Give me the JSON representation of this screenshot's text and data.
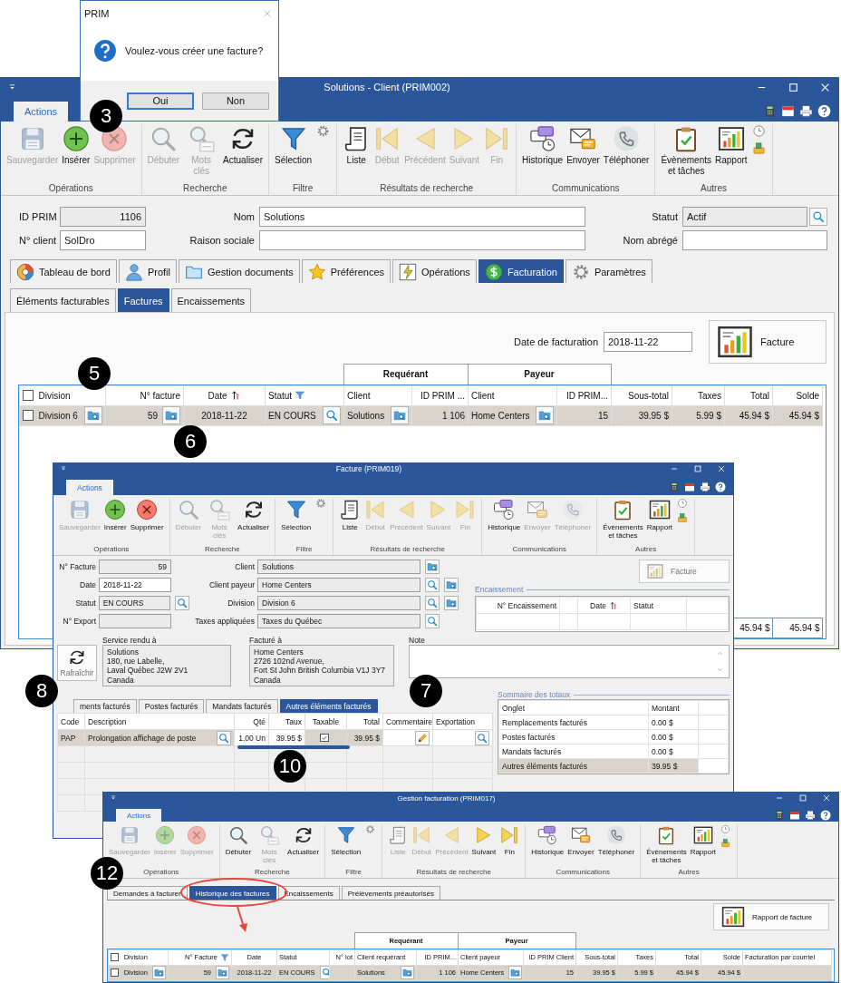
{
  "dialog": {
    "title": "PRIM",
    "message": "Voulez-vous créer une facture?",
    "buttons": [
      {
        "label": "Oui",
        "selected": true
      },
      {
        "label": "Non",
        "selected": false
      }
    ]
  },
  "windows": [
    {
      "kind": "client",
      "title": "Solutions - Client (PRIM002)",
      "ribbon_tabs": [
        {
          "label": "Actions",
          "selected": true
        }
      ],
      "groups": [
        {
          "label": "Opérations",
          "buttons": [
            {
              "kind": "save",
              "label": "Sauvegarder",
              "disabled": true
            },
            {
              "kind": "add",
              "label": "Insérer",
              "disabled": false
            },
            {
              "kind": "delete",
              "label": "Supprimer",
              "disabled": true
            }
          ]
        },
        {
          "label": "Recherche",
          "buttons": [
            {
              "kind": "search",
              "label": "Débuter",
              "disabled": true
            },
            {
              "kind": "keywords",
              "label": "Mots clés",
              "disabled": true
            },
            {
              "kind": "refresh",
              "label": "Actualiser",
              "disabled": false
            }
          ]
        },
        {
          "label": "Filtre",
          "buttons": [
            {
              "kind": "filter",
              "label": "Sélection",
              "disabled": false
            },
            {
              "kind": "gear"
            }
          ]
        },
        {
          "label": "Résultats de recherche",
          "buttons": [
            {
              "kind": "list",
              "label": "Liste",
              "disabled": false
            },
            {
              "kind": "first",
              "label": "Début",
              "disabled": true
            },
            {
              "kind": "previous",
              "label": "Précédent",
              "disabled": true
            },
            {
              "kind": "next",
              "label": "Suivant",
              "disabled": true
            },
            {
              "kind": "last",
              "label": "Fin",
              "disabled": true
            }
          ]
        },
        {
          "label": "Communications",
          "buttons": [
            {
              "kind": "history",
              "label": "Historique",
              "disabled": false
            },
            {
              "kind": "mail",
              "label": "Envoyer",
              "disabled": false
            },
            {
              "kind": "phone",
              "label": "Téléphoner",
              "disabled": false
            }
          ]
        },
        {
          "label": "Autres",
          "buttons": [
            {
              "kind": "tasks",
              "label": "Évènements et tâches",
              "disabled": false
            },
            {
              "kind": "report",
              "label": "Rapport",
              "disabled": false
            },
            {
              "kind": "clock"
            },
            {
              "kind": "money"
            }
          ]
        }
      ],
      "fields": [
        {
          "label": "ID PRIM",
          "value": "1106",
          "readonly": true
        },
        {
          "label": "Nom",
          "value": "Solutions",
          "readonly": false
        },
        {
          "label": "Statut",
          "value": "Actif",
          "readonly": true,
          "buttons": [
            {
              "kind": "search"
            }
          ]
        },
        {
          "label": "N° client",
          "value": "SolDro",
          "readonly": false
        },
        {
          "label": "Raison sociale",
          "readonly": false
        },
        {
          "label": "Nom abrégé",
          "readonly": false
        }
      ],
      "tabs": [
        {
          "label": "Tableau de bord",
          "kind": "dashboard",
          "selected": false
        },
        {
          "label": "Profil",
          "kind": "profile",
          "selected": false
        },
        {
          "label": "Gestion documents",
          "kind": "documents",
          "selected": false
        },
        {
          "label": "Préférences",
          "kind": "preferences",
          "selected": false
        },
        {
          "label": "Opérations",
          "kind": "operations",
          "selected": false
        },
        {
          "label": "Facturation",
          "kind": "billing",
          "selected": true
        },
        {
          "label": "Paramètres",
          "kind": "settings",
          "selected": false
        }
      ],
      "subtabs": [
        {
          "label": "Éléments facturables",
          "selected": false
        },
        {
          "label": "Factures",
          "selected": true
        },
        {
          "label": "Encaissements",
          "selected": false
        }
      ],
      "billing_date": {
        "label": "Date de facturation",
        "value": "2018-11-22"
      },
      "report_button": {
        "label": "Facture",
        "disabled": false
      },
      "grid": {
        "groups": [
          "Requérant",
          "Payeur"
        ],
        "select_all": false,
        "columns": [
          {
            "label": "Division"
          },
          {
            "label": "N° facture"
          },
          {
            "label": "Date",
            "kind": "sorted"
          },
          {
            "label": "Statut",
            "kind": "filtered"
          },
          {
            "label": "Client"
          },
          {
            "label": "ID PRIM ..."
          },
          {
            "label": "Client"
          },
          {
            "label": "ID PRIM..."
          },
          {
            "label": "Sous-total"
          },
          {
            "label": "Taxes"
          },
          {
            "label": "Total"
          },
          {
            "label": "Solde"
          }
        ],
        "rows": [
          {
            "checked": false,
            "cells": [
              {
                "text": "Division 6",
                "buttons": [
                  {
                    "kind": "lookup"
                  }
                ]
              },
              {
                "text": "59",
                "buttons": [
                  {
                    "kind": "lookup"
                  }
                ]
              },
              {
                "text": "2018-11-22"
              },
              {
                "text": "EN COURS",
                "buttons": [
                  {
                    "kind": "search"
                  }
                ]
              },
              {
                "text": "Solutions",
                "buttons": [
                  {
                    "kind": "lookup"
                  }
                ]
              },
              {
                "text": "1 106"
              },
              {
                "text": "Home Centers",
                "buttons": [
                  {
                    "kind": "lookup"
                  }
                ]
              },
              {
                "text": "15"
              },
              {
                "text": "39.95 $"
              },
              {
                "text": "5.99 $"
              },
              {
                "text": "45.94 $"
              },
              {
                "text": "45.94 $"
              }
            ]
          }
        ],
        "totals": [
          "45.94 $",
          "45.94 $"
        ]
      }
    },
    {
      "kind": "invoice",
      "title": "Facture (PRIM019)",
      "ribbon_tabs": [
        {
          "label": "Actions",
          "selected": true
        }
      ],
      "groups": [
        {
          "label": "Opérations",
          "buttons": [
            {
              "kind": "save",
              "label": "Sauvegarder",
              "disabled": true
            },
            {
              "kind": "add",
              "label": "Insérer",
              "disabled": false
            },
            {
              "kind": "delete",
              "label": "Supprimer",
              "disabled": false
            }
          ]
        },
        {
          "label": "Recherche",
          "buttons": [
            {
              "kind": "search",
              "label": "Débuter",
              "disabled": true
            },
            {
              "kind": "keywords",
              "label": "Mots clés",
              "disabled": true
            },
            {
              "kind": "refresh",
              "label": "Actualiser",
              "disabled": false
            }
          ]
        },
        {
          "label": "Filtre",
          "buttons": [
            {
              "kind": "filter",
              "label": "Sélection",
              "disabled": false
            },
            {
              "kind": "gear"
            }
          ]
        },
        {
          "label": "Résultats de recherche",
          "buttons": [
            {
              "kind": "list",
              "label": "Liste",
              "disabled": false
            },
            {
              "kind": "first",
              "label": "Début",
              "disabled": true
            },
            {
              "kind": "previous",
              "label": "Précédent",
              "disabled": true
            },
            {
              "kind": "next",
              "label": "Suivant",
              "disabled": true
            },
            {
              "kind": "last",
              "label": "Fin",
              "disabled": true
            }
          ]
        },
        {
          "label": "Communications",
          "buttons": [
            {
              "kind": "history",
              "label": "Historique",
              "disabled": false
            },
            {
              "kind": "mail",
              "label": "Envoyer",
              "disabled": true
            },
            {
              "kind": "phone",
              "label": "Téléphoner",
              "disabled": true
            }
          ]
        },
        {
          "label": "Autres",
          "buttons": [
            {
              "kind": "tasks",
              "label": "Évènements et tâches",
              "disabled": false
            },
            {
              "kind": "report",
              "label": "Rapport",
              "disabled": false
            },
            {
              "kind": "clock"
            },
            {
              "kind": "money"
            }
          ]
        }
      ],
      "fields": [
        {
          "label": "N° Facture",
          "value": "59",
          "readonly": true
        },
        {
          "label": "Date",
          "value": "2018-11-22",
          "readonly": false
        },
        {
          "label": "Statut",
          "value": "EN COURS",
          "readonly": true,
          "buttons": [
            {
              "kind": "search"
            }
          ]
        },
        {
          "label": "N° Export",
          "readonly": true
        },
        {
          "label": "Client",
          "value": "Solutions",
          "readonly": true,
          "buttons": [
            {
              "kind": "lookup"
            }
          ]
        },
        {
          "label": "Client payeur",
          "value": "Home Centers",
          "readonly": true,
          "buttons": [
            {
              "kind": "search"
            },
            {
              "kind": "lookup"
            }
          ]
        },
        {
          "label": "Division",
          "value": "Division 6",
          "readonly": true,
          "buttons": [
            {
              "kind": "search"
            },
            {
              "kind": "lookup"
            }
          ]
        },
        {
          "label": "Taxes appliquées",
          "value": "Taxes du Québec",
          "readonly": true,
          "buttons": [
            {
              "kind": "search"
            }
          ]
        }
      ],
      "report_button": {
        "label": "Facture",
        "disabled": true
      },
      "payments": {
        "title": "Encaissement",
        "columns": [
          {
            "label": "N° Encaissement"
          },
          {
            "label": "Date",
            "kind": "sorted"
          },
          {
            "label": "Statut"
          }
        ]
      },
      "refresh_button": {
        "label": "Rafraîchir",
        "disabled": true
      },
      "addresses": [
        {
          "label": "Service rendu à",
          "lines": [
            "Solutions",
            "180, rue Labelle,",
            "Laval Québec J2W 2V1",
            "Canada"
          ]
        },
        {
          "label": "Facturé à",
          "lines": [
            "Home Centers",
            "2726 102nd Avenue,",
            "Fort St John British Columbia V1J 3Y7",
            "Canada"
          ]
        }
      ],
      "note": {
        "label": "Note"
      },
      "tabs": [
        {
          "label": "ments facturés",
          "selected": false
        },
        {
          "label": "Postes facturés",
          "selected": false
        },
        {
          "label": "Mandats facturés",
          "selected": false
        },
        {
          "label": "Autres éléments facturés",
          "selected": true
        }
      ],
      "grid": {
        "columns": [
          {
            "label": "Code"
          },
          {
            "label": "Description"
          },
          {
            "label": "Qté"
          },
          {
            "label": "Taux"
          },
          {
            "label": "Taxable"
          },
          {
            "label": "Total"
          },
          {
            "label": "Commentaire"
          },
          {
            "label": "Exportation"
          }
        ],
        "rows": [
          {
            "cells": [
              {
                "text": "PAP",
                "readonly": true
              },
              {
                "text": "Prolongation affichage de poste",
                "readonly": true,
                "buttons": [
                  {
                    "kind": "search"
                  }
                ]
              },
              {
                "text": "1.00 Un"
              },
              {
                "text": "39.95 $"
              },
              {
                "kind": "checkbox",
                "checked": true,
                "readonly": true
              },
              {
                "text": "39.95 $",
                "readonly": true
              },
              {
                "buttons": [
                  {
                    "kind": "edit"
                  }
                ]
              },
              {
                "buttons": [
                  {
                    "kind": "search"
                  }
                ]
              }
            ]
          }
        ]
      },
      "summary": {
        "title": "Sommaire des totaux",
        "columns": [
          {
            "label": "Onglet"
          },
          {
            "label": "Montant"
          }
        ],
        "rows": [
          {
            "label": "Remplacements facturés",
            "amount": "0.00 $",
            "selected": false
          },
          {
            "label": "Postes facturés",
            "amount": "0.00 $",
            "selected": false
          },
          {
            "label": "Mandats facturés",
            "amount": "0.00 $",
            "selected": false
          },
          {
            "label": "Autres éléments facturés",
            "amount": "39.95 $",
            "selected": true
          }
        ]
      }
    },
    {
      "kind": "billing",
      "title": "Gestion facturation (PRIM017)",
      "ribbon_tabs": [
        {
          "label": "Actions",
          "selected": true
        }
      ],
      "groups": [
        {
          "label": "Opérations",
          "buttons": [
            {
              "kind": "save",
              "label": "Sauvegarder",
              "disabled": true
            },
            {
              "kind": "add",
              "label": "Insérer",
              "disabled": true
            },
            {
              "kind": "delete",
              "label": "Supprimer",
              "disabled": true
            }
          ]
        },
        {
          "label": "Recherche",
          "buttons": [
            {
              "kind": "search",
              "label": "Débuter",
              "disabled": false
            },
            {
              "kind": "keywords",
              "label": "Mots clés",
              "disabled": true
            },
            {
              "kind": "refresh",
              "label": "Actualiser",
              "disabled": false
            }
          ]
        },
        {
          "label": "Filtre",
          "buttons": [
            {
              "kind": "filter",
              "label": "Sélection",
              "disabled": false
            },
            {
              "kind": "gear"
            }
          ]
        },
        {
          "label": "Résultats de recherche",
          "buttons": [
            {
              "kind": "list",
              "label": "Liste",
              "disabled": true
            },
            {
              "kind": "first",
              "label": "Début",
              "disabled": true
            },
            {
              "kind": "previous",
              "label": "Précédent",
              "disabled": true
            },
            {
              "kind": "next",
              "label": "Suivant",
              "disabled": false
            },
            {
              "kind": "last",
              "label": "Fin",
              "disabled": false
            }
          ]
        },
        {
          "label": "Communications",
          "buttons": [
            {
              "kind": "history",
              "label": "Historique",
              "disabled": false
            },
            {
              "kind": "mail",
              "label": "Envoyer",
              "disabled": false
            },
            {
              "kind": "phone",
              "label": "Téléphoner",
              "disabled": false
            }
          ]
        },
        {
          "label": "Autres",
          "buttons": [
            {
              "kind": "tasks",
              "label": "Évènements et tâches",
              "disabled": false
            },
            {
              "kind": "report",
              "label": "Rapport",
              "disabled": false
            },
            {
              "kind": "clock"
            },
            {
              "kind": "money"
            }
          ]
        }
      ],
      "tabs": [
        {
          "label": "Demandes à facturer",
          "selected": false
        },
        {
          "label": "Historique des factures",
          "selected": true
        },
        {
          "label": "Encaissements",
          "selected": false
        },
        {
          "label": "Prélèvements préautorisés",
          "selected": false
        }
      ],
      "report_button": {
        "label": "Rapport de facture",
        "disabled": false
      },
      "grid": {
        "groups": [
          "Requérant",
          "Payeur"
        ],
        "select_all": false,
        "columns": [
          {
            "label": "Division"
          },
          {
            "label": "N° Facture",
            "kind": "filtered"
          },
          {
            "label": "Date"
          },
          {
            "label": "Statut"
          },
          {
            "label": "N° lot"
          },
          {
            "label": "Client requérant"
          },
          {
            "label": "ID PRIM..."
          },
          {
            "label": "Client payeur"
          },
          {
            "label": "ID PRIM Client"
          },
          {
            "label": "Sous-total"
          },
          {
            "label": "Taxes"
          },
          {
            "label": "Total"
          },
          {
            "label": "Solde"
          },
          {
            "label": "Facturation par courriel"
          }
        ],
        "rows": [
          {
            "checked": false,
            "cells": [
              {
                "text": "Division",
                "buttons": [
                  {
                    "kind": "lookup"
                  }
                ]
              },
              {
                "text": "59",
                "buttons": [
                  {
                    "kind": "lookup"
                  }
                ]
              },
              {
                "text": "2018-11-22"
              },
              {
                "text": "EN COURS",
                "buttons": [
                  {
                    "kind": "search"
                  }
                ]
              },
              {},
              {
                "text": "Solutions",
                "buttons": [
                  {
                    "kind": "lookup"
                  }
                ]
              },
              {
                "text": "1 106"
              },
              {
                "text": "Home Centers",
                "buttons": [
                  {
                    "kind": "lookup"
                  }
                ]
              },
              {
                "text": "15"
              },
              {
                "text": "39.95 $"
              },
              {
                "text": "5.99 $"
              },
              {
                "text": "45.94 $"
              },
              {
                "text": "45.94 $"
              },
              {}
            ]
          }
        ]
      }
    }
  ],
  "callouts": [
    "3",
    "5",
    "6",
    "7",
    "8",
    "10",
    "12"
  ]
}
